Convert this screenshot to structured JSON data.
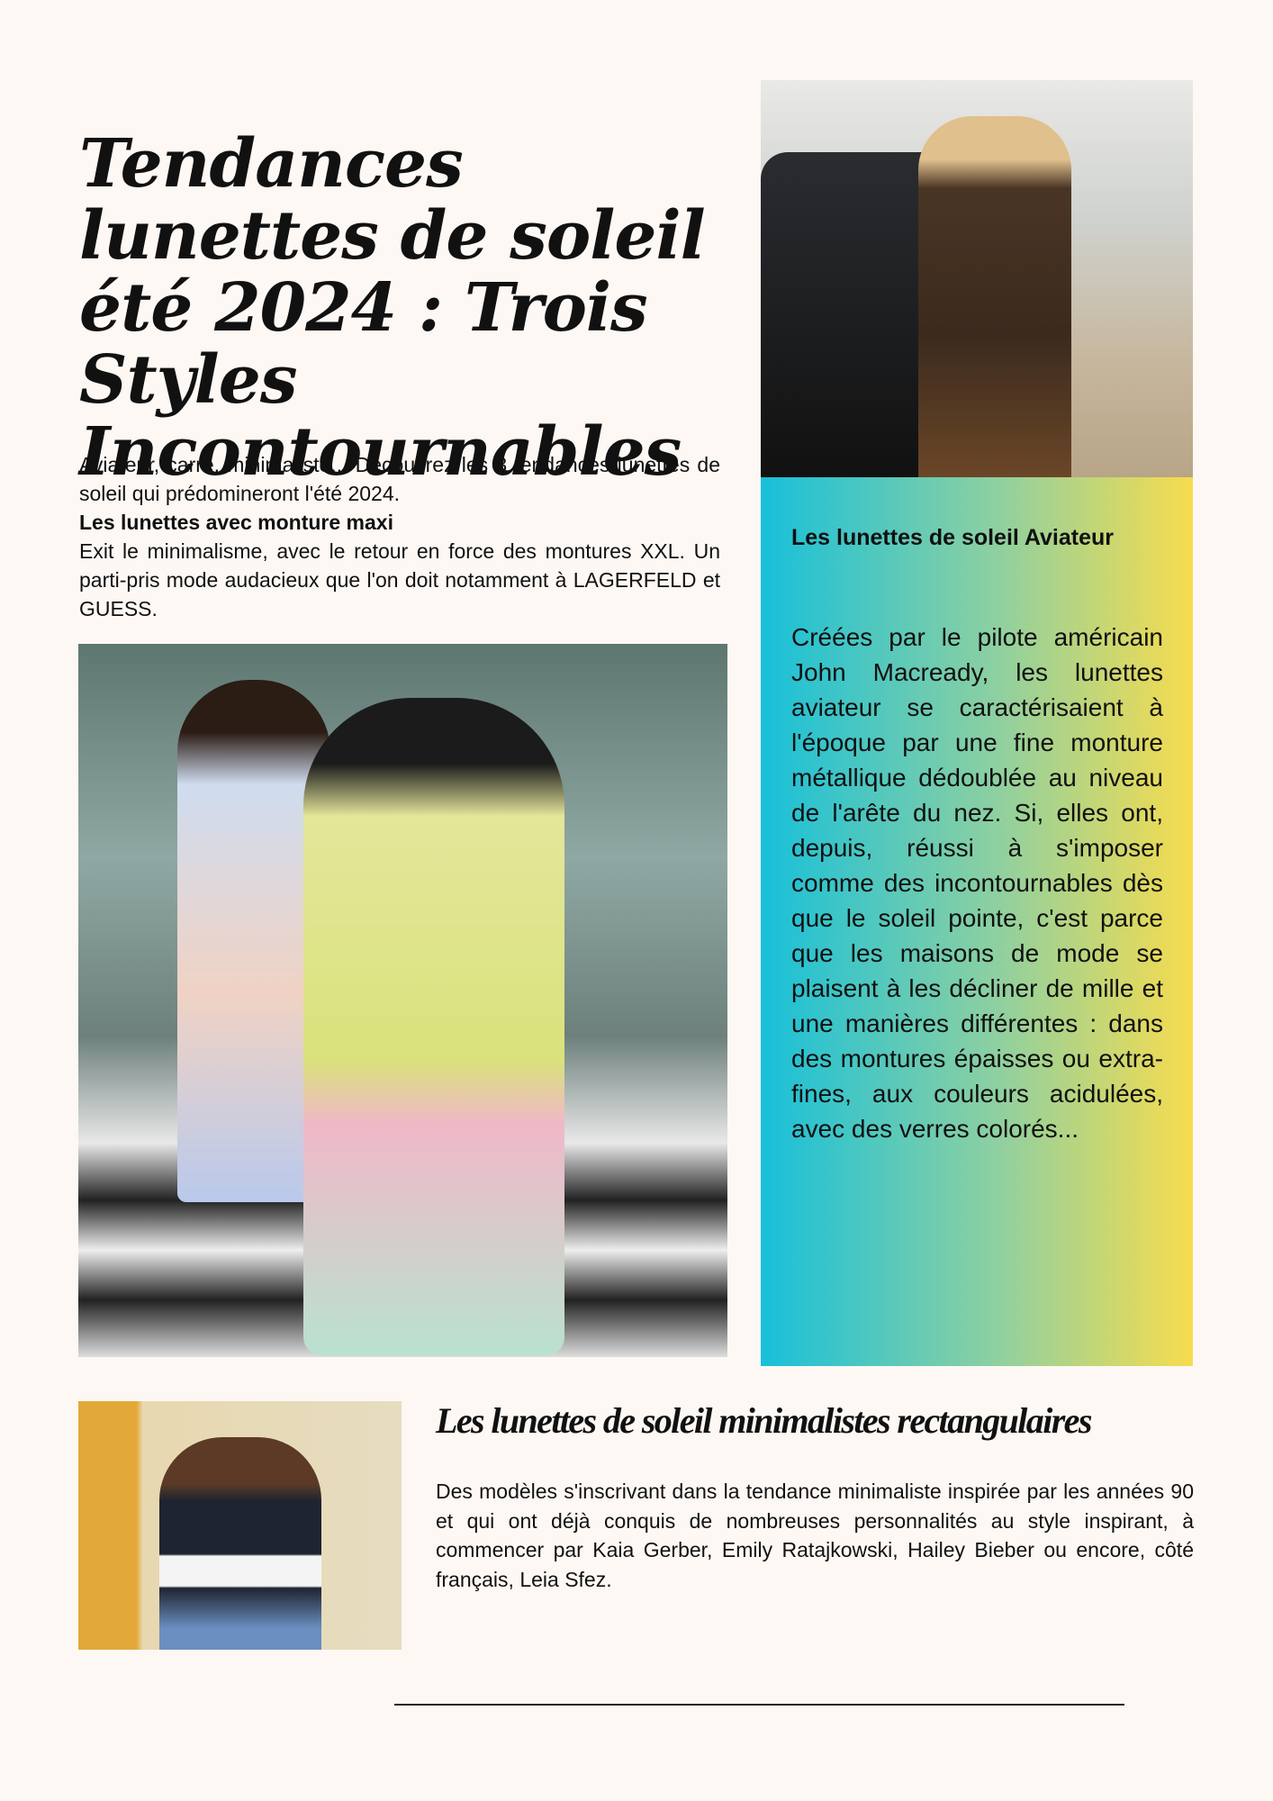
{
  "article": {
    "title": "Tendances lunettes de soleil été 2024 : Trois Styles Incontournables",
    "intro": "Aviateur, carré, minimaliste... Découvrez les 3 tendances lunettes de soleil qui prédomineront l'été 2024.",
    "section1": {
      "heading": "Les lunettes avec monture maxi",
      "body": "Exit le minimalisme, avec le retour en force des montures XXL. Un parti-pris mode audacieux que l'on doit notamment à LAGERFELD et GUESS."
    },
    "section2": {
      "heading": "Les lunettes de soleil Aviateur",
      "body": "Créées par le pilote américain John Macready, les lunettes aviateur se caractérisaient à l'époque par une fine monture métallique dédoublée au niveau de l'arête du nez. Si, elles ont, depuis, réussi à s'imposer comme des incontournables dès que le soleil pointe, c'est parce que les maisons de mode se plaisent à les décliner de mille et une manières différentes : dans des montures épaisses ou extra-fines, aux couleurs acidulées, avec des verres colorés..."
    },
    "section3": {
      "heading": "Les lunettes de soleil minimalistes rectangulaires",
      "body": "Des modèles s'inscrivant dans la tendance minimaliste inspirée par les années 90 et qui ont déjà conquis de nombreuses personnalités au style inspirant, à commencer par Kaia Gerber, Emily Ratajkowski, Hailey Bieber ou encore, côté français, Leia Sfez."
    }
  },
  "colors": {
    "background": "#fdf8f4",
    "gradient_start": "#17c0da",
    "gradient_end": "#f7dc4e"
  }
}
